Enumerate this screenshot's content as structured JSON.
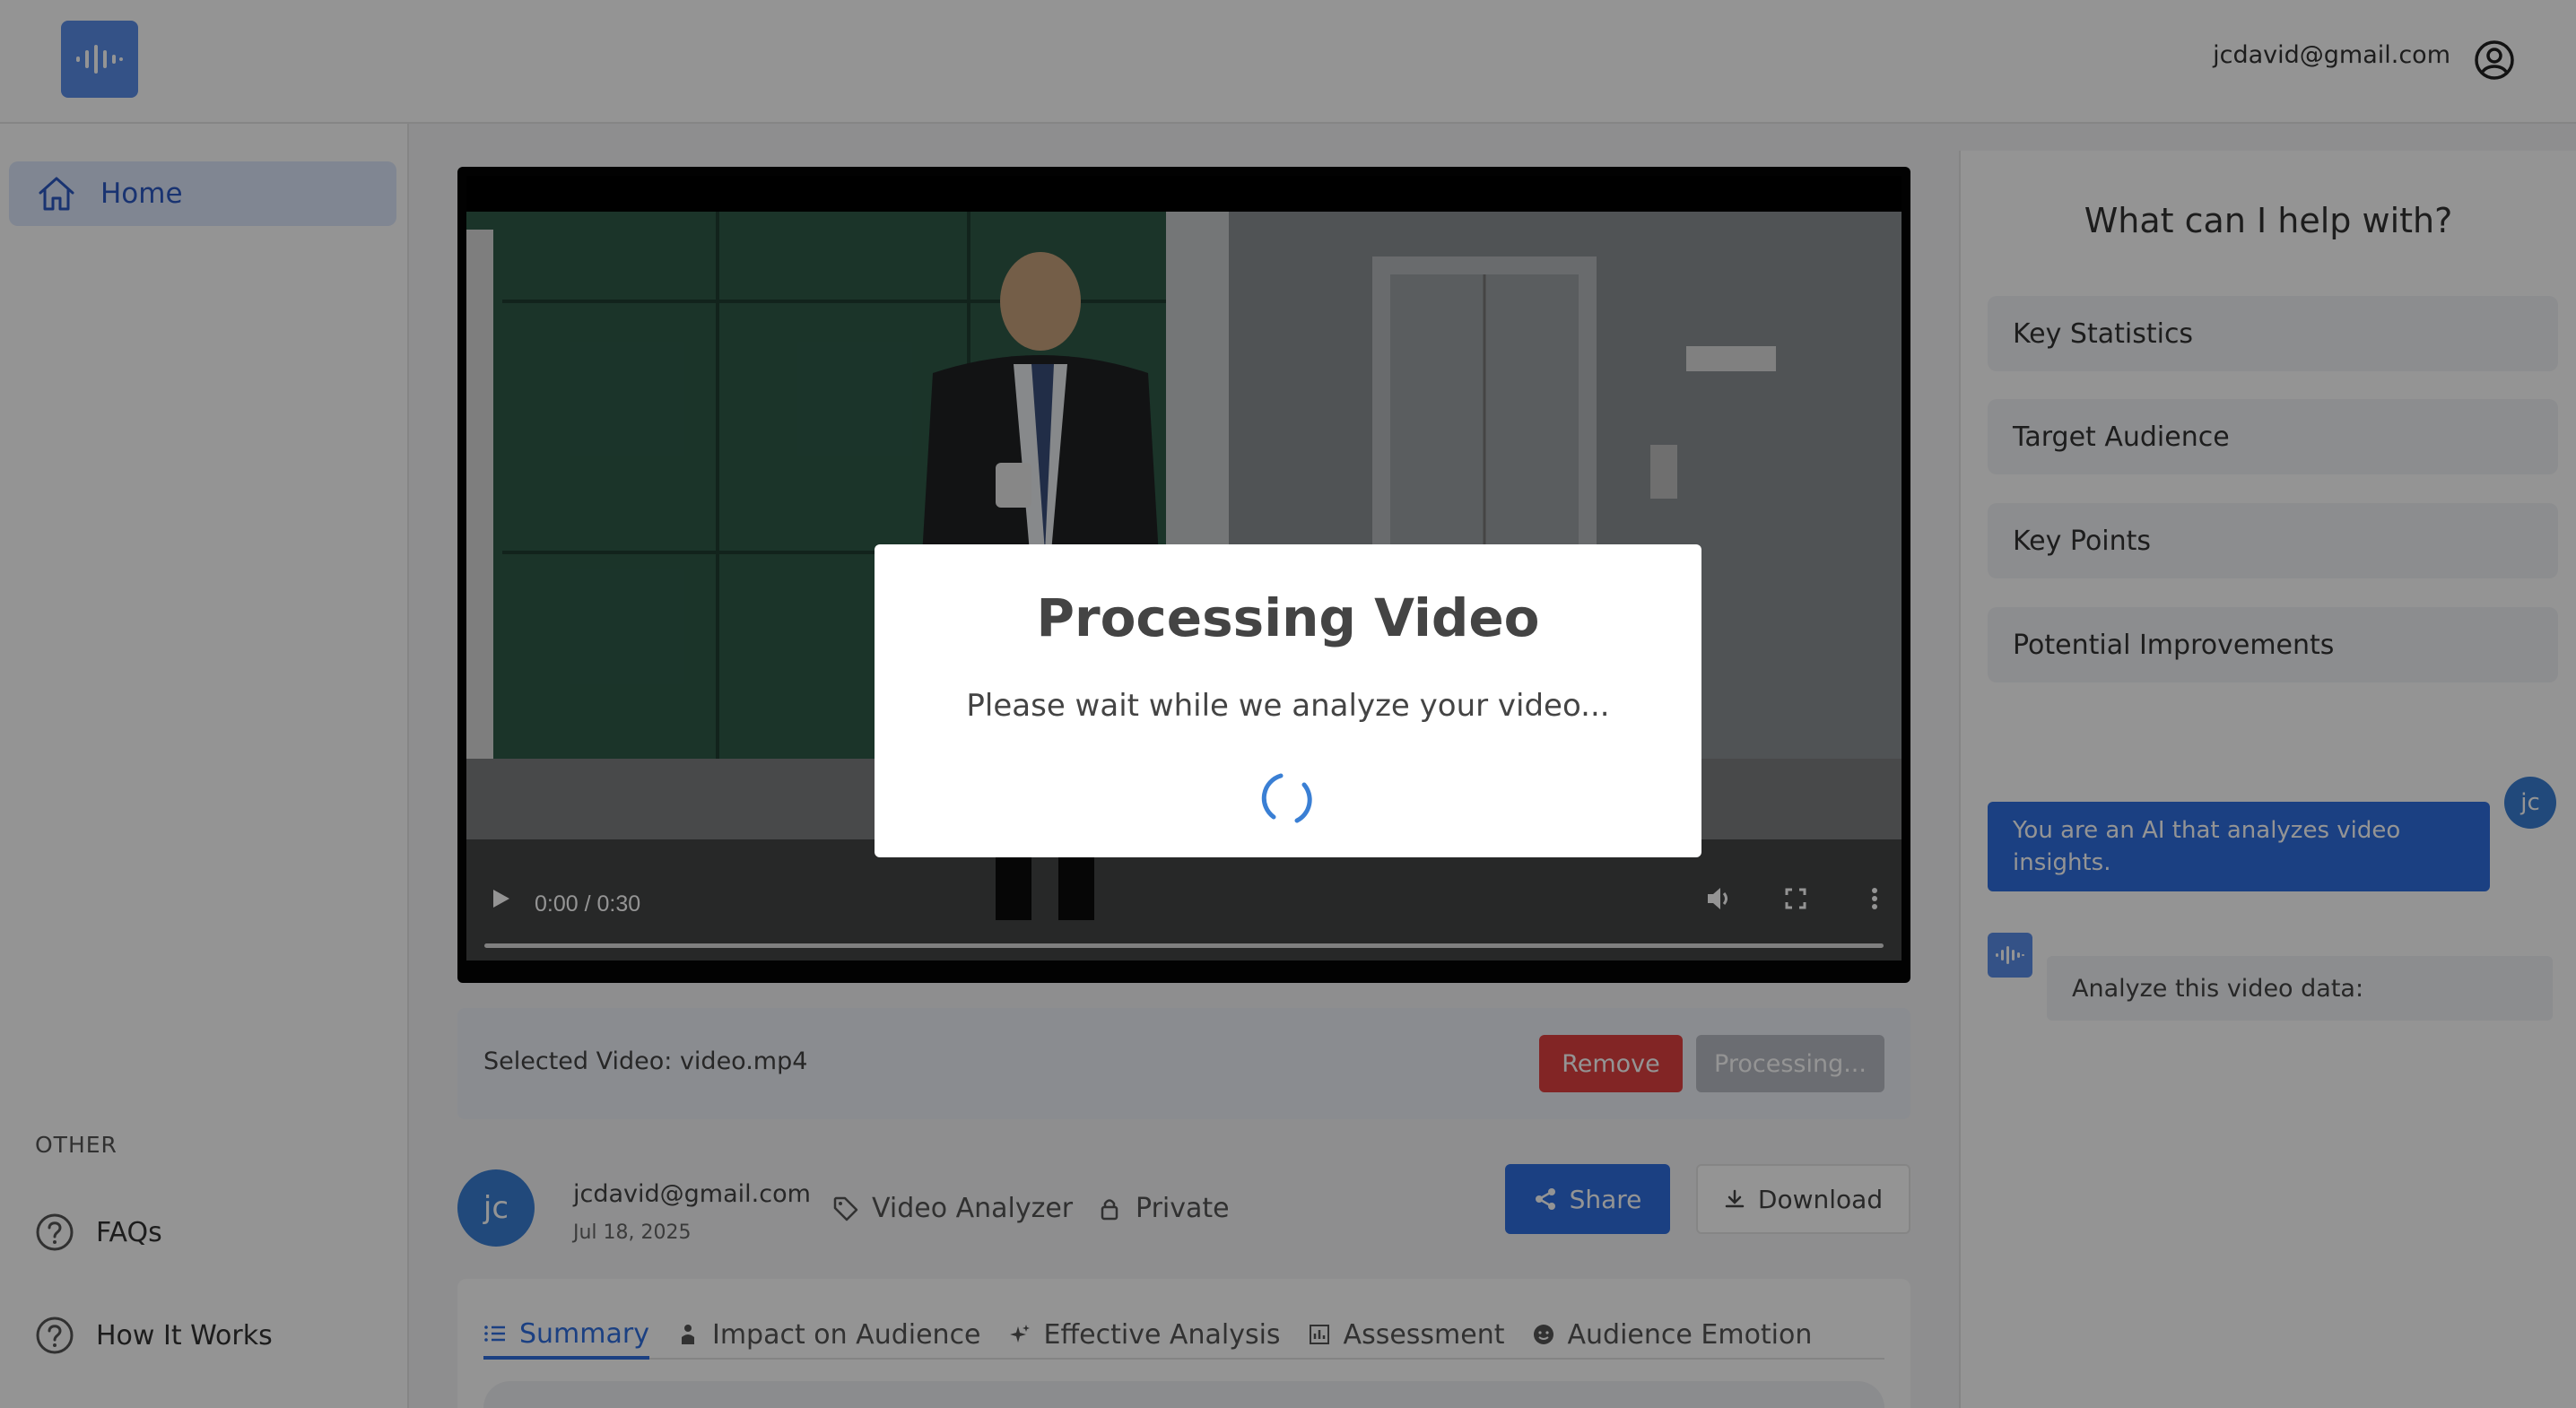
{
  "header": {
    "user_email": "jcdavid@gmail.com"
  },
  "sidebar": {
    "home_label": "Home",
    "section_label": "OTHER",
    "items": [
      {
        "label": "FAQs"
      },
      {
        "label": "How It Works"
      }
    ]
  },
  "video": {
    "time": "0:00 / 0:30",
    "progress": 0
  },
  "selected": {
    "label": "Selected Video: video.mp4",
    "remove_label": "Remove",
    "processing_label": "Processing..."
  },
  "author": {
    "avatar_initials": "jc",
    "email": "jcdavid@gmail.com",
    "date": "Jul 18, 2025",
    "category": "Video Analyzer",
    "visibility": "Private",
    "share_label": "Share",
    "download_label": "Download"
  },
  "tabs": [
    {
      "label": "Summary",
      "active": true
    },
    {
      "label": "Impact on Audience"
    },
    {
      "label": "Effective Analysis"
    },
    {
      "label": "Assessment"
    },
    {
      "label": "Audience Emotion"
    }
  ],
  "assistant": {
    "title": "What can I help with?",
    "suggestions": [
      "Key Statistics",
      "Target Audience",
      "Key Points",
      "Potential Improvements"
    ],
    "user_avatar": "jc",
    "user_message": "You are an AI that analyzes video insights.",
    "bot_message": "Analyze this video data:"
  },
  "modal": {
    "title": "Processing Video",
    "subtitle": "Please wait while we analyze your video..."
  },
  "colors": {
    "accent": "#2f6fe0",
    "danger": "#e04040"
  }
}
